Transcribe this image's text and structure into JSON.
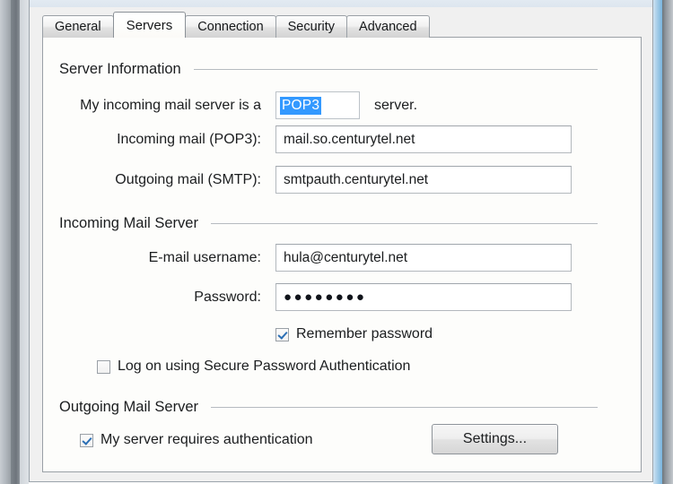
{
  "dialog": {
    "tabs": [
      {
        "label": "General",
        "active": false
      },
      {
        "label": "Servers",
        "active": true
      },
      {
        "label": "Connection",
        "active": false
      },
      {
        "label": "Security",
        "active": false
      },
      {
        "label": "Advanced",
        "active": false
      }
    ],
    "groups": {
      "server_information": "Server Information",
      "incoming_mail_server": "Incoming Mail Server",
      "outgoing_mail_server": "Outgoing Mail Server"
    },
    "server_information": {
      "incoming_type_label": "My incoming mail server is a",
      "incoming_type_value": "POP3",
      "incoming_type_suffix": "server.",
      "incoming_mail_label": "Incoming mail (POP3):",
      "incoming_mail_value": "mail.so.centurytel.net",
      "outgoing_mail_label": "Outgoing mail (SMTP):",
      "outgoing_mail_value": "smtpauth.centurytel.net"
    },
    "incoming_mail_server": {
      "username_label": "E-mail username:",
      "username_value": "hula@centurytel.net",
      "password_label": "Password:",
      "password_value": "●●●●●●●●",
      "remember_password_label": "Remember password",
      "remember_password_checked": true,
      "spa_label": "Log on using Secure Password Authentication",
      "spa_checked": false
    },
    "outgoing_mail_server": {
      "requires_auth_label": "My server requires authentication",
      "requires_auth_checked": true,
      "settings_button_label": "Settings..."
    }
  },
  "colors": {
    "selection_blue": "#3399ff",
    "check_blue": "#2b6fb5",
    "panel_bg": "#fdfdfb",
    "dialog_bg": "#f0f0f0"
  }
}
